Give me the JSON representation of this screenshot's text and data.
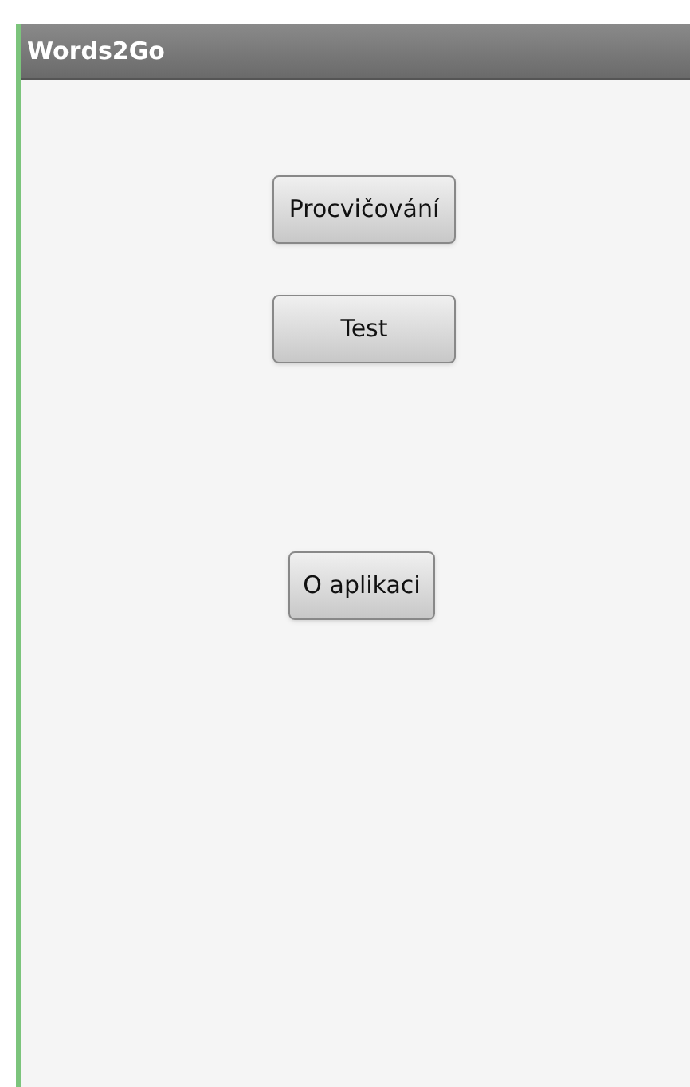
{
  "window": {
    "title": "Words2Go"
  },
  "buttons": [
    {
      "label": "Procvičování"
    },
    {
      "label": "Test"
    },
    {
      "label": "O aplikaci"
    }
  ]
}
